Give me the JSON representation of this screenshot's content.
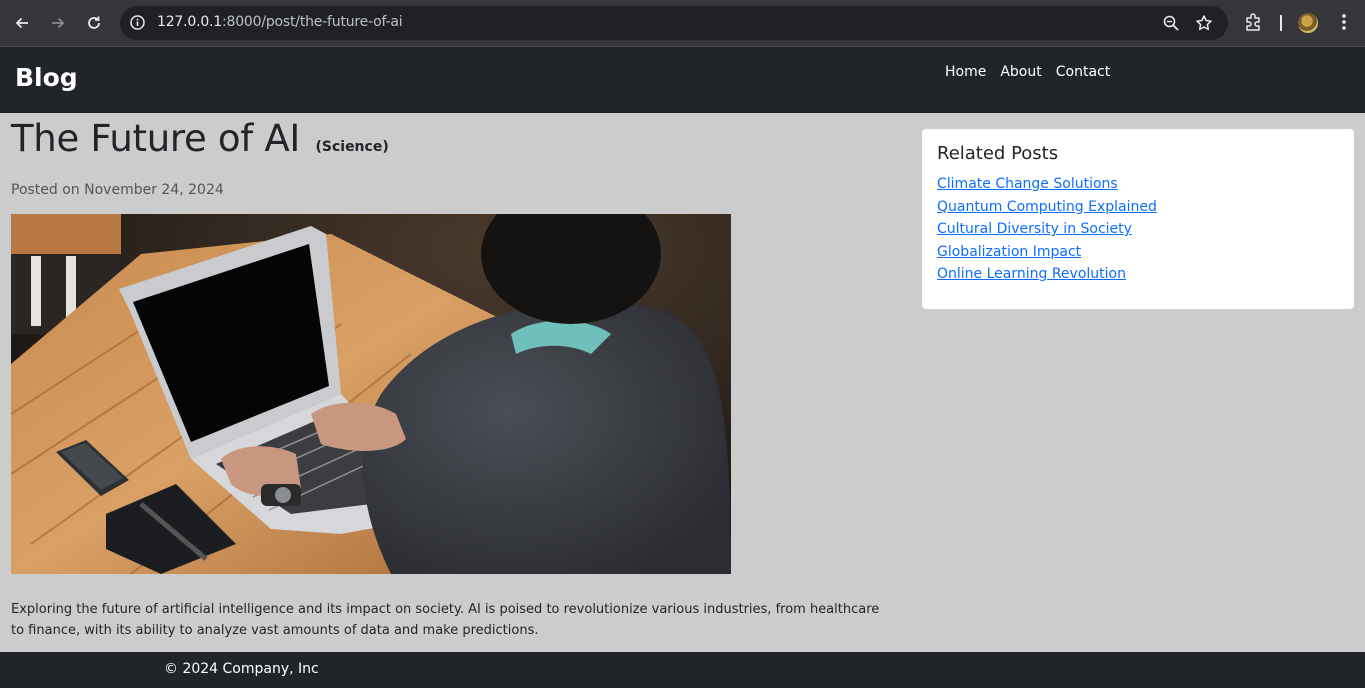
{
  "browser": {
    "url_host": "127.0.0.1",
    "url_rest": ":8000/post/the-future-of-ai",
    "icons": [
      "back-icon",
      "forward-icon",
      "reload-icon",
      "info-icon",
      "zoom-icon",
      "star-icon",
      "extensions-icon",
      "menu-icon"
    ]
  },
  "navbar": {
    "brand": "Blog",
    "links": [
      "Home",
      "About",
      "Contact"
    ]
  },
  "post": {
    "title": "The Future of AI",
    "category": "(Science)",
    "posted": "Posted on November 24, 2024",
    "body": "Exploring the future of artificial intelligence and its impact on society. AI is poised to revolutionize various industries, from healthcare to finance, with its ability to analyze vast amounts of data and make predictions."
  },
  "sidebar": {
    "heading": "Related Posts",
    "links": [
      "Climate Change Solutions",
      "Quantum Computing Explained",
      "Cultural Diversity in Society",
      "Globalization Impact",
      "Online Learning Revolution"
    ]
  },
  "footer": {
    "text": "© 2024 Company, Inc"
  },
  "colors": {
    "navbar": "#212529",
    "page_bg": "#cccccc",
    "link": "#0d6efd"
  }
}
